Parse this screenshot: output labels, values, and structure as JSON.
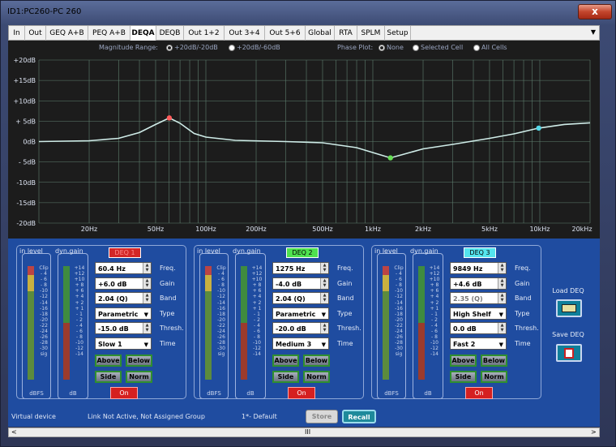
{
  "window": {
    "title": "ID1:PC260-PC 260",
    "close": "x"
  },
  "tabs": [
    "In",
    "Out",
    "GEQ A+B",
    "PEQ A+B",
    "DEQA",
    "DEQB",
    "Out 1+2",
    "Out 3+4",
    "Out 5+6",
    "Global",
    "RTA",
    "SPLM",
    "Setup"
  ],
  "active_tab": "DEQA",
  "options": {
    "magnitude_label": "Magnitude Range:",
    "mag_opt1": "+20dB/-20dB",
    "mag_opt2": "+20dB/-60dB",
    "phase_label": "Phase Plot:",
    "phase_opt1": "None",
    "phase_opt2": "Selected Cell",
    "phase_opt3": "All Cells"
  },
  "chart_data": {
    "type": "line",
    "y_ticks": [
      "+20dB",
      "+15dB",
      "+10dB",
      "+ 5dB",
      "0dB",
      "- 5dB",
      "-10dB",
      "-15dB",
      "-20dB"
    ],
    "x_ticks": [
      "20Hz",
      "50Hz",
      "100Hz",
      "200Hz",
      "500Hz",
      "1kHz",
      "2kHz",
      "5kHz",
      "10kHz",
      "20kHz"
    ],
    "ylim": [
      -20,
      20
    ],
    "xlim": [
      10,
      20000
    ],
    "x_scale": "log",
    "grid": true,
    "series": [
      {
        "values": [
          [
            10,
            0
          ],
          [
            20,
            0.2
          ],
          [
            30,
            0.8
          ],
          [
            40,
            2.2
          ],
          [
            50,
            4.2
          ],
          [
            60.4,
            5.8
          ],
          [
            70,
            4.5
          ],
          [
            85,
            2
          ],
          [
            100,
            1.1
          ],
          [
            150,
            0.3
          ],
          [
            300,
            0
          ],
          [
            500,
            -0.3
          ],
          [
            800,
            -1.5
          ],
          [
            1100,
            -3.2
          ],
          [
            1275,
            -4
          ],
          [
            1500,
            -3.2
          ],
          [
            2000,
            -1.8
          ],
          [
            3000,
            -0.7
          ],
          [
            5000,
            0.8
          ],
          [
            7000,
            1.9
          ],
          [
            9849,
            3.3
          ],
          [
            14000,
            4.2
          ],
          [
            20000,
            4.6
          ]
        ]
      }
    ],
    "markers": [
      {
        "x": 60.4,
        "y": 5.8,
        "color": "#ff5b5b"
      },
      {
        "x": 1275,
        "y": -4,
        "color": "#66dd55"
      },
      {
        "x": 9849,
        "y": 3.3,
        "color": "#55d8e8"
      }
    ],
    "line_color": "#cfece8"
  },
  "meter": {
    "in_label": "in level",
    "dyn_label": "dyn.gain",
    "dbfs": "dBFS",
    "db": "dB",
    "in_scale": [
      "Clip",
      "- 4",
      "- 6",
      "- 8",
      "-10",
      "-12",
      "-14",
      "-16",
      "-18",
      "-20",
      "-22",
      "-24",
      "-26",
      "-28",
      "-30",
      "sig"
    ],
    "dyn_scale": [
      "+14",
      "+12",
      "+10",
      "+ 8",
      "+ 6",
      "+ 4",
      "+ 2",
      "+ 1",
      "- 1",
      "- 2",
      "- 4",
      "- 6",
      "- 8",
      "-10",
      "-12",
      "-14"
    ]
  },
  "labels": {
    "freq": "Freq.",
    "gain": "Gain",
    "band": "Band",
    "type": "Type",
    "thresh": "Thresh.",
    "time": "Time",
    "above": "Above",
    "below": "Below",
    "side": "Side",
    "norm": "Norm",
    "on": "On"
  },
  "deq": [
    {
      "name": "DEQ 1",
      "name_bg": "#d32727",
      "name_color": "#ff8a8a",
      "freq": "60.4 Hz",
      "gain": "+6.0 dB",
      "band": "2.04 (Q)",
      "type": "Parametric",
      "thresh": "-15.0 dB",
      "time": "Slow 1"
    },
    {
      "name": "DEQ 2",
      "name_bg": "#4fe24f",
      "name_color": "#000",
      "freq": "1275 Hz",
      "gain": "-4.0 dB",
      "band": "2.04 (Q)",
      "type": "Parametric",
      "thresh": "-20.0 dB",
      "time": "Medium 3"
    },
    {
      "name": "DEQ 3",
      "name_bg": "#55e5ee",
      "name_color": "#000",
      "freq": "9849 Hz",
      "gain": "+4.6 dB",
      "band": "2.35 (Q)",
      "type": "High Shelf",
      "thresh": "0.0 dB",
      "time": "Fast 2"
    }
  ],
  "side": {
    "load": "Load DEQ",
    "save": "Save DEQ"
  },
  "status": {
    "device": "Virtual device",
    "link": "Link Not Active,  Not Assigned Group",
    "preset": "1*- Default",
    "store": "Store",
    "recall": "Recall"
  },
  "scroll": {
    "left": "<",
    "right": ">",
    "thumb": "III"
  }
}
